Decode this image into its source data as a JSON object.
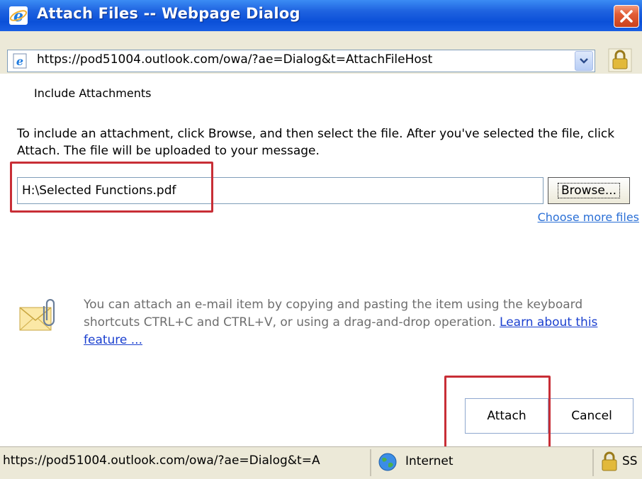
{
  "window": {
    "title": "Attach Files -- Webpage Dialog",
    "close_label": "Close",
    "address": "https://pod51004.outlook.com/owa/?ae=Dialog&t=AttachFileHost"
  },
  "dialog": {
    "heading": "Include Attachments",
    "instructions": "To include an attachment, click Browse, and then select the file. After you've selected the file, click Attach. The file will be uploaded to your message.",
    "file_value": "H:\\Selected Functions.pdf",
    "browse_label": "Browse...",
    "more_files_link": "Choose more files",
    "note_text": "You can attach an e-mail item by copying and pasting the item using the keyboard shortcuts CTRL+C and CTRL+V, or using a drag-and-drop operation.",
    "note_link": "Learn about this feature ...",
    "attach_label": "Attach",
    "cancel_label": "Cancel"
  },
  "status": {
    "url": "https://pod51004.outlook.com/owa/?ae=Dialog&t=A",
    "zone": "Internet",
    "security": "SS"
  },
  "icons": {
    "title": "ie-logo-icon",
    "address": "ie-page-icon",
    "dropdown": "chevron-down-icon",
    "lock": "padlock-icon",
    "envelope": "envelope-paperclip-icon",
    "zone": "globe-icon"
  },
  "colors": {
    "titlebar": "#0b50d8",
    "highlight_box": "#c82e36",
    "link": "#2a6fd6",
    "chrome": "#ece9d8"
  }
}
